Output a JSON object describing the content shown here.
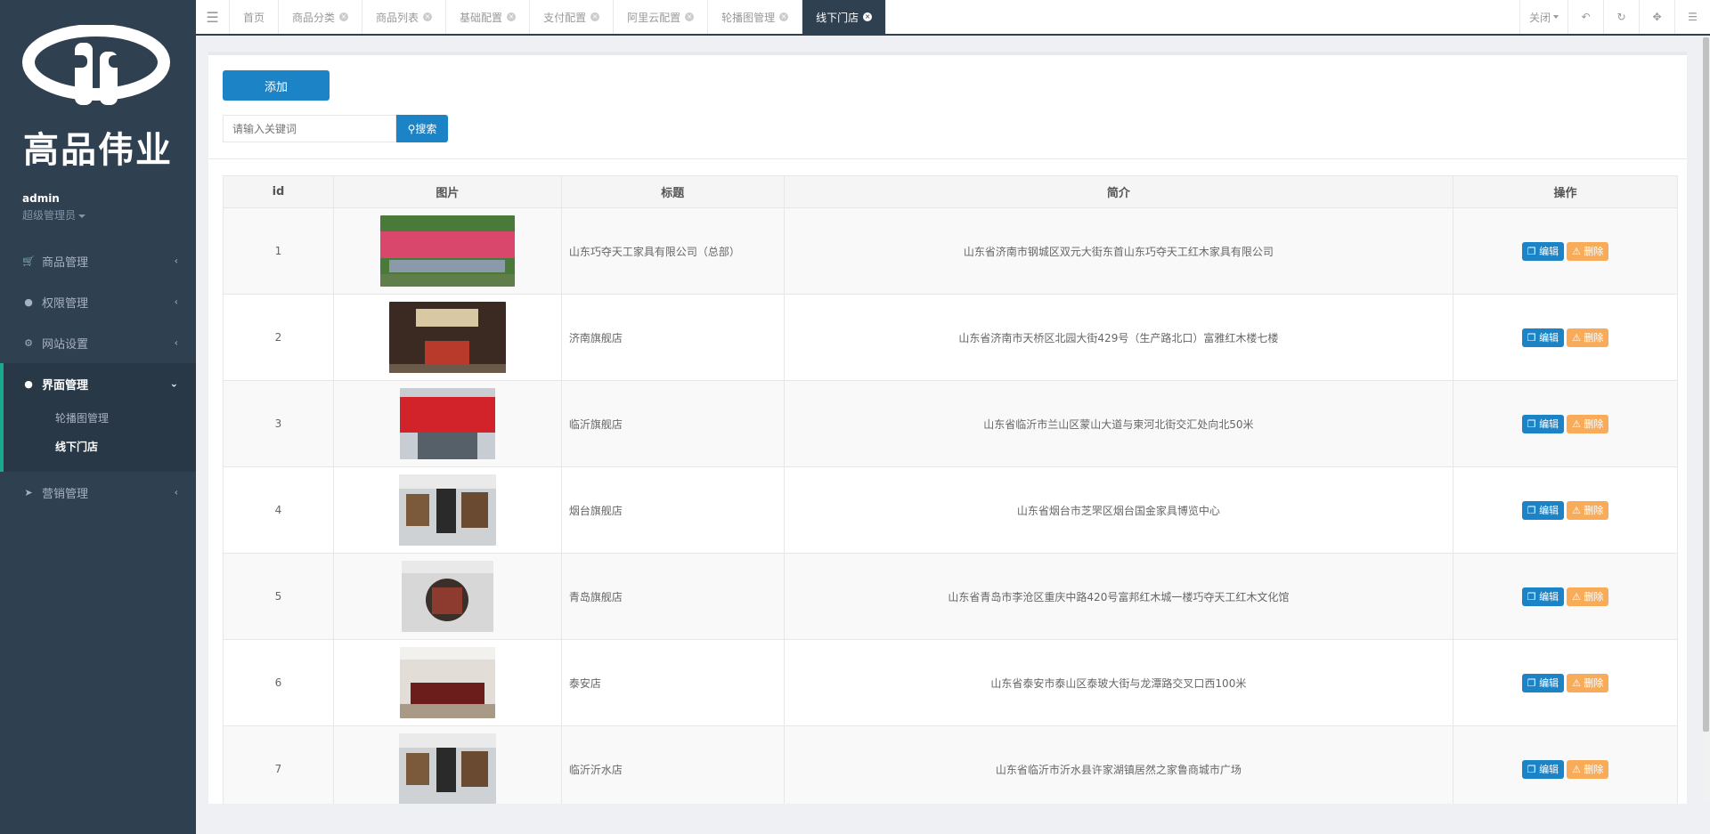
{
  "brand": {
    "name": "高品伟业"
  },
  "user": {
    "name": "admin",
    "role": "超级管理员"
  },
  "nav": [
    {
      "label": "商品管理",
      "icon": "cart-icon"
    },
    {
      "label": "权限管理",
      "icon": "users-icon"
    },
    {
      "label": "网站设置",
      "icon": "gear-icon"
    },
    {
      "label": "界面管理",
      "icon": "users-icon",
      "expanded": true,
      "children": [
        {
          "label": "轮播图管理"
        },
        {
          "label": "线下门店",
          "current": true
        }
      ]
    },
    {
      "label": "营销管理",
      "icon": "bullhorn-icon"
    }
  ],
  "tabs": [
    {
      "label": "首页"
    },
    {
      "label": "商品分类"
    },
    {
      "label": "商品列表"
    },
    {
      "label": "基础配置"
    },
    {
      "label": "支付配置"
    },
    {
      "label": "阿里云配置"
    },
    {
      "label": "轮播图管理"
    },
    {
      "label": "线下门店",
      "active": true
    }
  ],
  "tools": {
    "close_label": "关闭"
  },
  "toolbar": {
    "add_label": "添加"
  },
  "search": {
    "placeholder": "请输入关键词",
    "button_label": "搜索"
  },
  "table": {
    "headers": [
      "id",
      "图片",
      "标题",
      "简介",
      "操作"
    ],
    "edit_label": "编辑",
    "delete_label": "删除",
    "rows": [
      {
        "id": "1",
        "title": "山东巧夺天工家具有限公司（总部）",
        "desc": "山东省济南市钢城区双元大街东首山东巧夺天工红木家具有限公司",
        "image": "factory-aerial"
      },
      {
        "id": "2",
        "title": "济南旗舰店",
        "desc": "山东省济南市天桥区北园大街429号（生产路北口）富雅红木楼七楼",
        "image": "showroom-chandelier"
      },
      {
        "id": "3",
        "title": "临沂旗舰店",
        "desc": "山东省临沂市兰山区蒙山大道与柬河北街交汇处向北50米",
        "image": "storefront-red"
      },
      {
        "id": "4",
        "title": "烟台旗舰店",
        "desc": "山东省烟台市芝罘区烟台国金家具博览中心",
        "image": "showroom-hall"
      },
      {
        "id": "5",
        "title": "青岛旗舰店",
        "desc": "山东省青岛市李沧区重庆中路420号富邦红木城一楼巧夺天工红木文化馆",
        "image": "shop-entrance"
      },
      {
        "id": "6",
        "title": "泰安店",
        "desc": "山东省泰安市泰山区泰玻大街与龙潭路交叉口西100米",
        "image": "showroom-furniture"
      },
      {
        "id": "7",
        "title": "临沂沂水店",
        "desc": "山东省临沂市沂水县许家湖镇居然之家鲁商城市广场",
        "image": "showroom-hall"
      }
    ]
  }
}
